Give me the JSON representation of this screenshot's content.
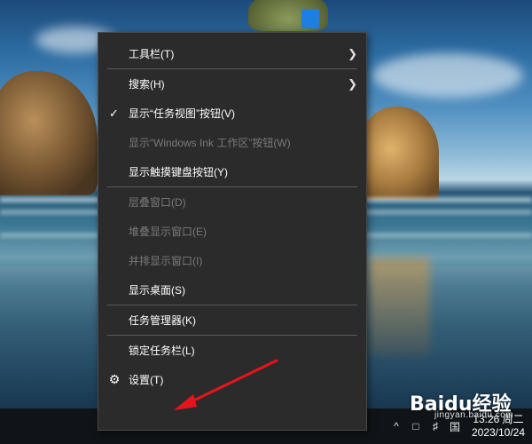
{
  "menu": {
    "items": [
      {
        "label": "工具栏(T)",
        "enabled": true,
        "submenu": true
      },
      {
        "label": "搜索(H)",
        "enabled": true,
        "submenu": true
      },
      {
        "label": "显示“任务视图”按钮(V)",
        "enabled": true,
        "checked": true
      },
      {
        "label": "显示“Windows Ink 工作区”按钮(W)",
        "enabled": false
      },
      {
        "label": "显示触摸键盘按钮(Y)",
        "enabled": true
      },
      {
        "label": "层叠窗口(D)",
        "enabled": false
      },
      {
        "label": "堆叠显示窗口(E)",
        "enabled": false
      },
      {
        "label": "并排显示窗口(I)",
        "enabled": false
      },
      {
        "label": "显示桌面(S)",
        "enabled": true
      },
      {
        "label": "任务管理器(K)",
        "enabled": true
      },
      {
        "label": "锁定任务栏(L)",
        "enabled": true
      },
      {
        "label": "设置(T)",
        "enabled": true,
        "icon": "gear-icon"
      }
    ]
  },
  "taskbar": {
    "clock_time": "13:26 周二",
    "clock_date": "2023/10/24",
    "tray_icons": [
      "show-hidden-icons-chevron",
      "network-icon",
      "volume-icon",
      "input-method-icon"
    ]
  },
  "watermark": {
    "logo_text": "Baidu经验",
    "sub_text": "jingyan.baidu.com"
  },
  "colors": {
    "menu_bg": "#2b2b2b",
    "menu_text": "#ffffff",
    "menu_disabled_text": "#7a7a7a",
    "separator": "#5a5a5a",
    "taskbar_bg": "#101418",
    "annotation_arrow": "#e8141c"
  }
}
